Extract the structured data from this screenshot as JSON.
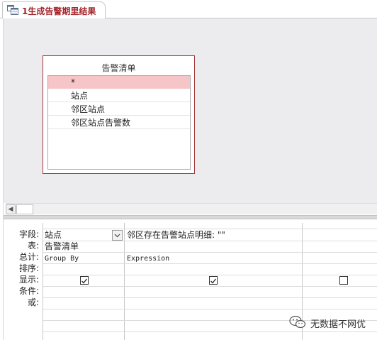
{
  "tab": {
    "title": "1生成告警期里结果"
  },
  "table": {
    "title": "告警清单",
    "fields": [
      "*",
      "站点",
      "邻区站点",
      "邻区站点告警数"
    ]
  },
  "grid": {
    "row_labels": [
      "字段:",
      "表:",
      "总计:",
      "排序:",
      "显示:",
      "条件:",
      "或:"
    ],
    "columns": [
      {
        "field": "站点",
        "table": "告警清单",
        "total": "Group By",
        "show": true
      },
      {
        "field": "邻区存在告警站点明细: \"\"",
        "table": "",
        "total": "Expression",
        "show": true
      },
      {
        "field": "",
        "table": "",
        "total": "",
        "show": false
      }
    ]
  },
  "watermark": {
    "text": "无数据不网优"
  }
}
